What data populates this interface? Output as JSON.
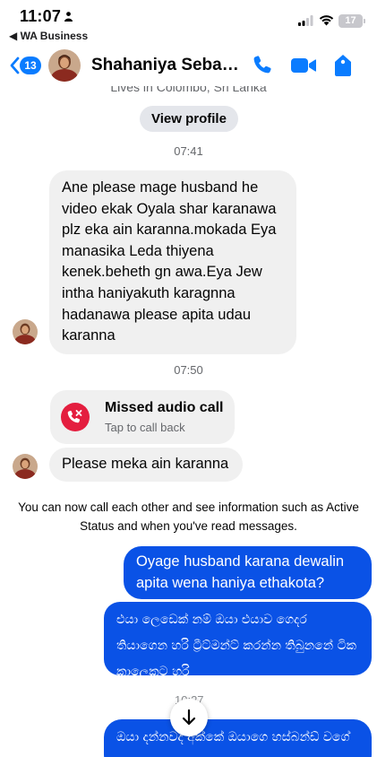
{
  "status_bar": {
    "time": "11:07",
    "back_app": "◀ WA Business",
    "battery": "17"
  },
  "header": {
    "unread_count": "13",
    "contact_name": "Shahaniya Sebas...",
    "icons": [
      "chevron-left-icon",
      "phone-icon",
      "video-camera-icon",
      "tag-icon"
    ]
  },
  "chat": {
    "subtitle": "Lives in Colombo, Sri Lanka",
    "view_profile": "View profile",
    "time_1": "07:41",
    "msg_1": "Ane please mage husband he video ekak Oyala shar karanawa plz eka ain karanna.mokada Eya manasika Leda thiyena kenek.beheth gn awa.Eya Jew intha haniyakuth karagnna hadanawa please apita udau karanna",
    "time_2": "07:50",
    "missed_call_title": "Missed audio call",
    "missed_call_sub": "Tap to call back",
    "msg_2": "Please meka ain karanna",
    "system_note": "You can now call each other and see information such as Active Status and when you've read messages.",
    "out_1": "Oyage husband karana dewalin apita wena haniya ethakota?",
    "out_2": "එයා ලෙඩෙක් නම් ඔයා එයාව ගෙදර තියාගෙන හරි ට්‍රීට්මන්ට් කරන්න තිබුනනේ ටික කාලෙකට හරි",
    "time_3_partial": "10:27",
    "out_3_partial": "ඔයා දන්නවද අක්කේ ඔයාගෙ හස්බන්ඩ් වගේ"
  },
  "colors": {
    "accent": "#0a7cff",
    "outgoing_bubble": "#0a52e6",
    "incoming_bubble": "#f0f0f0",
    "missed_call_red": "#e41e3f"
  }
}
